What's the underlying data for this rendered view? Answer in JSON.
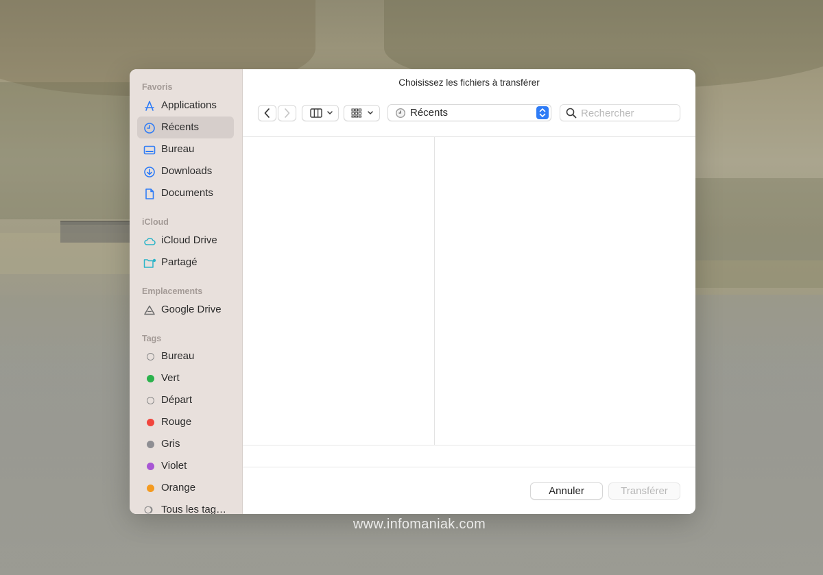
{
  "dialog": {
    "title": "Choisissez les fichiers à transférer",
    "location": {
      "label": "Récents",
      "icon": "clock-icon"
    },
    "search": {
      "placeholder": "Rechercher"
    },
    "buttons": {
      "cancel": "Annuler",
      "transfer": "Transférer"
    }
  },
  "sidebar": {
    "sections": [
      {
        "title": "Favoris",
        "items": [
          {
            "label": "Applications",
            "icon": "applications-icon"
          },
          {
            "label": "Récents",
            "icon": "clock-icon",
            "selected": true
          },
          {
            "label": "Bureau",
            "icon": "desktop-icon"
          },
          {
            "label": "Downloads",
            "icon": "download-icon"
          },
          {
            "label": "Documents",
            "icon": "document-icon"
          }
        ]
      },
      {
        "title": "iCloud",
        "items": [
          {
            "label": "iCloud Drive",
            "icon": "cloud-icon"
          },
          {
            "label": "Partagé",
            "icon": "shared-folder-icon"
          }
        ]
      },
      {
        "title": "Emplacements",
        "items": [
          {
            "label": "Google Drive",
            "icon": "google-drive-icon"
          }
        ]
      },
      {
        "title": "Tags",
        "items": [
          {
            "label": "Bureau",
            "color": "none"
          },
          {
            "label": "Vert",
            "color": "#2bb24c"
          },
          {
            "label": "Départ",
            "color": "none"
          },
          {
            "label": "Rouge",
            "color": "#f1453d"
          },
          {
            "label": "Gris",
            "color": "#8e8e93"
          },
          {
            "label": "Violet",
            "color": "#a856d4"
          },
          {
            "label": "Orange",
            "color": "#f49a1f"
          },
          {
            "label": "Tous les tag…",
            "icon": "all-tags-icon"
          }
        ]
      }
    ]
  },
  "colors": {
    "accent": "#2f7cf6",
    "sidebar_bg": "#e8e0dc",
    "selected_bg": "#d6cecb"
  },
  "watermark": "www.infomaniak.com"
}
